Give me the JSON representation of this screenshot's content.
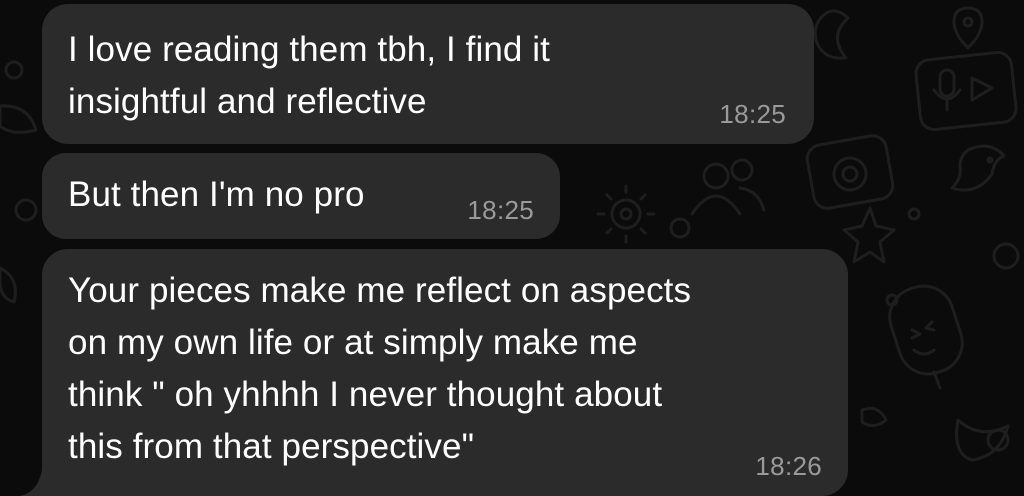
{
  "theme": {
    "background": "#0b0b0b",
    "bubble_color": "#2b2b2c",
    "text_color": "#ffffff",
    "timestamp_color": "#9a9a9b"
  },
  "messages": [
    {
      "text": "I love reading them tbh, I find it\ninsightful and reflective",
      "time": "18:25"
    },
    {
      "text": "But then I'm no pro",
      "time": "18:25"
    },
    {
      "text": "Your pieces make me reflect on aspects\non my own life or at simply make me\nthink \" oh yhhhh I never thought about\nthis from that perspective\"",
      "time": "18:26"
    }
  ],
  "wallpaper": {
    "icons": [
      "microphone-icon",
      "video-icon",
      "camera-icon",
      "people-icon",
      "gear-icon",
      "star-icon",
      "popsicle-icon",
      "bird-icon",
      "moon-icon",
      "location-pin-icon"
    ]
  }
}
